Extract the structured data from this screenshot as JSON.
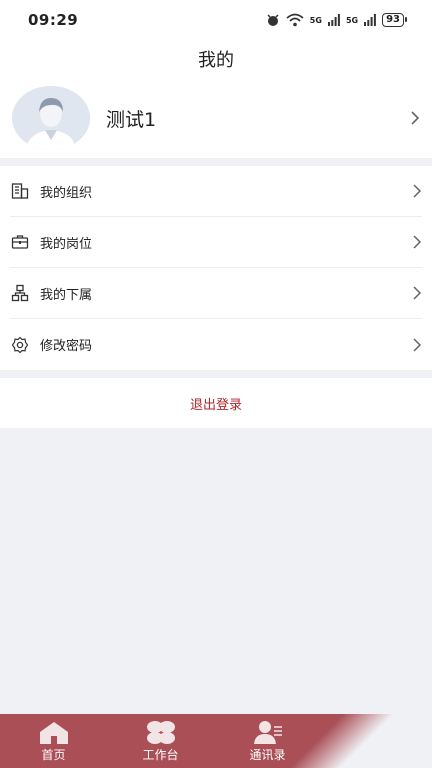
{
  "status": {
    "time": "09:29",
    "net1": "5G",
    "net2": "5G",
    "battery": "93"
  },
  "header": {
    "title": "我的"
  },
  "profile": {
    "name": "测试1"
  },
  "menu": [
    {
      "label": "我的组织",
      "icon": "building-icon"
    },
    {
      "label": "我的岗位",
      "icon": "briefcase-icon"
    },
    {
      "label": "我的下属",
      "icon": "org-chart-icon"
    },
    {
      "label": "修改密码",
      "icon": "gear-icon"
    }
  ],
  "logout": {
    "label": "退出登录",
    "color": "#b3262d"
  },
  "tabs": [
    {
      "label": "首页",
      "icon": "home-icon"
    },
    {
      "label": "工作台",
      "icon": "workbench-icon"
    },
    {
      "label": "通讯录",
      "icon": "contacts-icon"
    }
  ],
  "colors": {
    "tabbar": "#a94f55",
    "background": "#f0f1f5"
  }
}
